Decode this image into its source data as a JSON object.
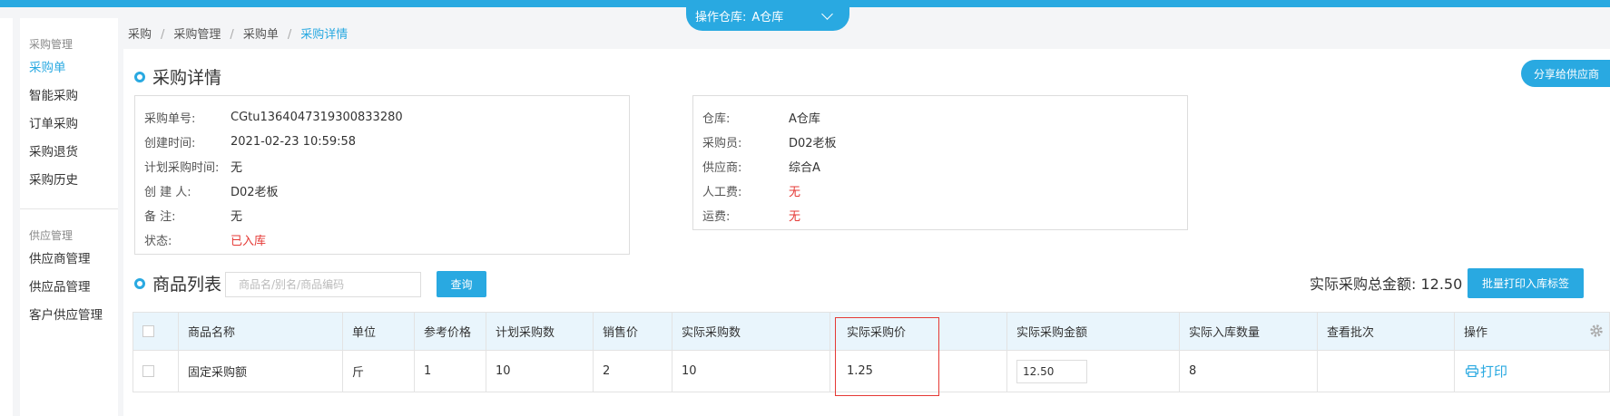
{
  "header": {
    "warehouse_label": "操作仓库:",
    "warehouse_value": "A仓库"
  },
  "sidebar": {
    "groups": [
      {
        "title": "采购管理",
        "items": [
          {
            "label": "采购单",
            "active": true
          },
          {
            "label": "智能采购"
          },
          {
            "label": "订单采购"
          },
          {
            "label": "采购退货"
          },
          {
            "label": "采购历史"
          }
        ]
      },
      {
        "title": "供应管理",
        "items": [
          {
            "label": "供应商管理"
          },
          {
            "label": "供应品管理"
          },
          {
            "label": "客户供应管理"
          }
        ]
      }
    ]
  },
  "breadcrumb": [
    "采购",
    "采购管理",
    "采购单",
    "采购详情"
  ],
  "detail": {
    "title": "采购详情",
    "share_label": "分享给供应商",
    "left": [
      {
        "key": "采购单号:",
        "value": "CGtu1364047319300833280"
      },
      {
        "key": "创建时间:",
        "value": "2021-02-23 10:59:58"
      },
      {
        "key": "计划采购时间:",
        "value": "无"
      },
      {
        "key": "创 建 人:",
        "value": "D02老板"
      },
      {
        "key": "备 注:",
        "value": "无"
      },
      {
        "key": "状态:",
        "value": "已入库",
        "color": "#e53935"
      }
    ],
    "right": [
      {
        "key": "仓库:",
        "value": "A仓库"
      },
      {
        "key": "采购员:",
        "value": "D02老板"
      },
      {
        "key": "供应商:",
        "value": "综合A"
      },
      {
        "key": "人工费:",
        "value": "无",
        "color": "#e53935"
      },
      {
        "key": "运费:",
        "value": "无",
        "color": "#e53935"
      }
    ]
  },
  "products": {
    "title": "商品列表",
    "search_placeholder": "商品名/别名/商品编码",
    "query_label": "查询",
    "total_label": "实际采购总金额: 12.50",
    "batch_print_label": "批量打印入库标签",
    "columns": [
      "商品名称",
      "单位",
      "参考价格",
      "计划采购数",
      "销售价",
      "实际采购数",
      "实际采购价",
      "实际采购金额",
      "实际入库数量",
      "查看批次",
      "操作"
    ],
    "rows": [
      {
        "name": "固定采购额",
        "unit": "斤",
        "ref_price": "1",
        "plan_qty": "10",
        "sale_price": "2",
        "actual_qty": "10",
        "actual_price": "1.25",
        "actual_amount": "12.50",
        "stock_qty": "8",
        "batch": "",
        "action": "打印"
      }
    ]
  },
  "colors": {
    "accent": "#29a9e1",
    "danger": "#e53935",
    "header_bg": "#e9f5fc"
  }
}
